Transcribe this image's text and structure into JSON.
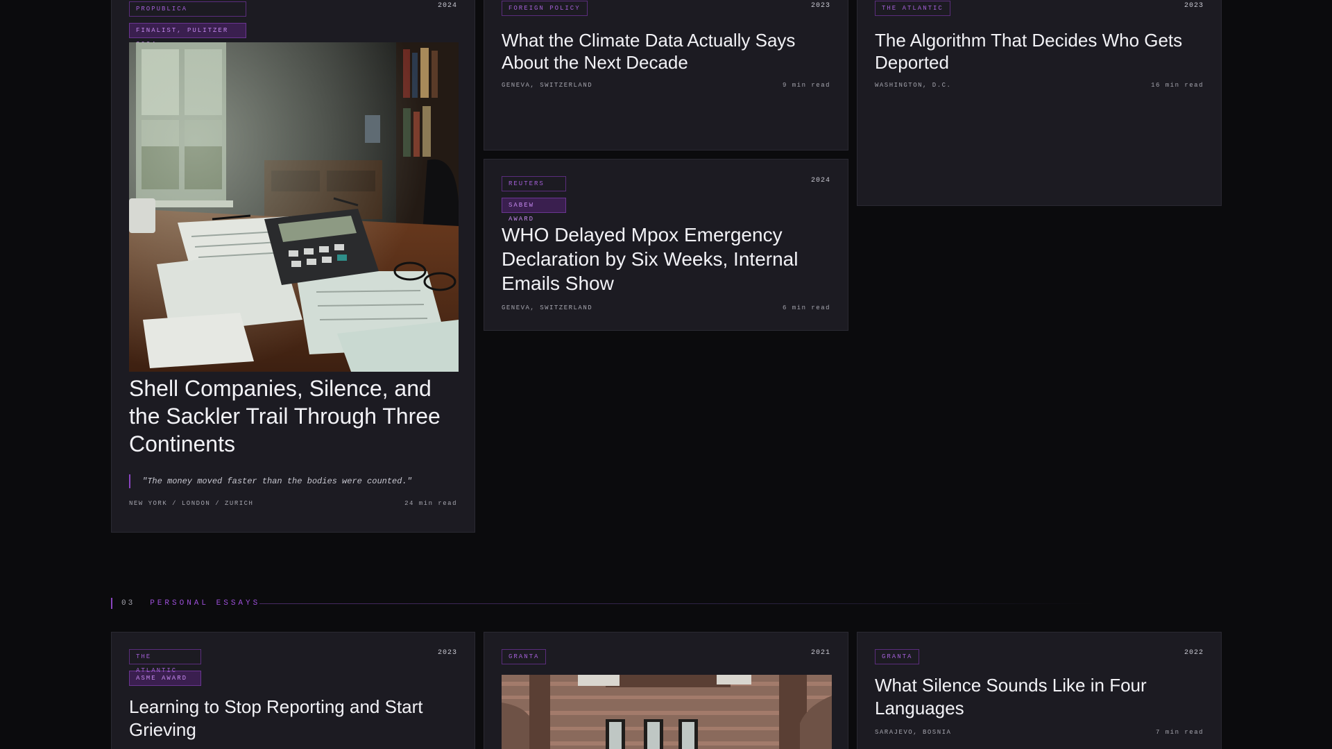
{
  "col1": {
    "c1": {
      "tags": [
        "ProPublica",
        "Finalist, Pulitzer 2024"
      ],
      "year": "2024",
      "title": "Shell Companies, Silence, and the Sackler Trail Through Three Continents",
      "quote": "\"The money moved faster than the bodies were counted.\"",
      "location": "New York / London / Zurich",
      "read": "24 min read"
    },
    "c2": {
      "tags": [
        "The Atlantic",
        "ASME Award"
      ],
      "year": "2023",
      "title": "Learning to Stop Reporting and Start Grieving"
    }
  },
  "col2": {
    "c1": {
      "tags": [
        "Foreign Policy"
      ],
      "year": "2023",
      "title": "What the Climate Data Actually Says About the Next Decade",
      "location": "Geneva, Switzerland",
      "read": "9 min read"
    },
    "c2": {
      "tags": [
        "Reuters",
        "Sabew Award"
      ],
      "year": "2024",
      "title": "WHO Delayed Mpox Emergency Declaration by Six Weeks, Internal Emails Show",
      "location": "Geneva, Switzerland",
      "read": "6 min read"
    },
    "c3": {
      "tags": [
        "Granta"
      ],
      "year": "2021"
    }
  },
  "col3": {
    "c1": {
      "tags": [
        "The Atlantic"
      ],
      "year": "2023",
      "title": "The Algorithm That Decides Who Gets Deported",
      "location": "Washington, D.C.",
      "read": "16 min read"
    },
    "c2": {
      "tags": [
        "Granta"
      ],
      "year": "2022",
      "title": "What Silence Sounds Like in Four Languages",
      "location": "Sarajevo, Bosnia",
      "read": "7 min read"
    }
  },
  "section": {
    "number": "03",
    "title": "PERSONAL ESSAYS"
  },
  "colors": {
    "accent": "#9c4fd8",
    "card": "#1c1b22",
    "background": "#0b0b0d"
  }
}
